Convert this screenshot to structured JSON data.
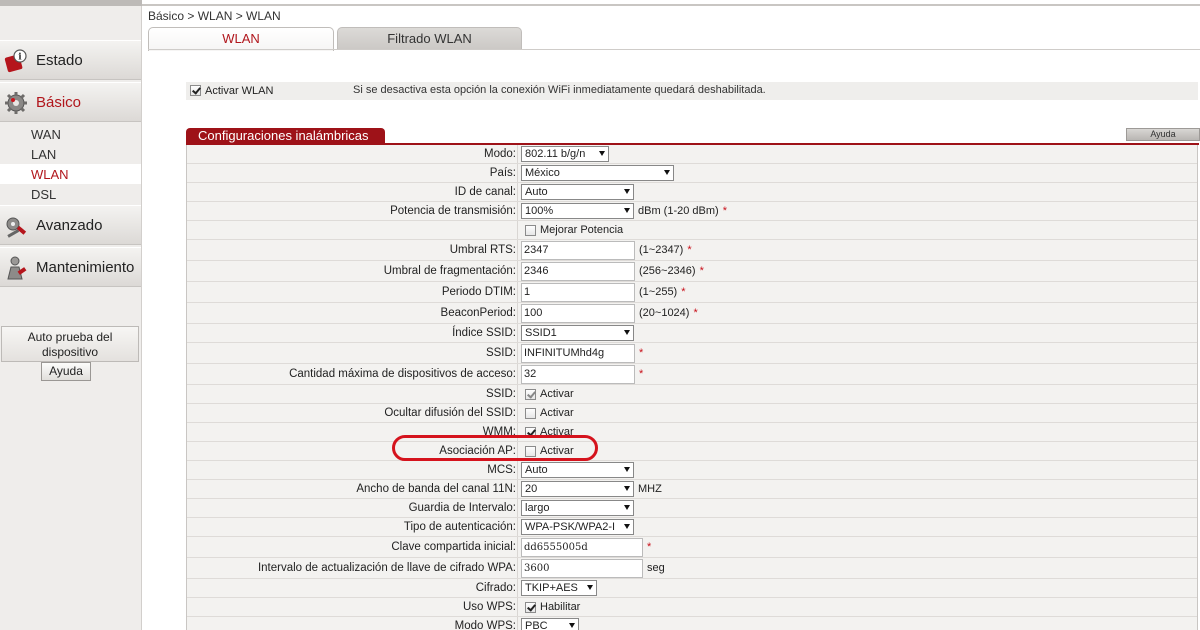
{
  "breadcrumb": "Básico > WLAN > WLAN",
  "tabs": [
    {
      "label": "WLAN",
      "active": true
    },
    {
      "label": "Filtrado WLAN",
      "active": false
    }
  ],
  "sidebar": {
    "menus": [
      {
        "label": "Estado",
        "icon": "info-icon"
      },
      {
        "label": "Básico",
        "icon": "gear-icon",
        "active": true
      },
      {
        "label": "Avanzado",
        "icon": "tools-icon"
      },
      {
        "label": "Mantenimiento",
        "icon": "maintenance-icon"
      }
    ],
    "submenu": [
      "WAN",
      "LAN",
      "WLAN",
      "DSL"
    ],
    "active_submenu": "WLAN",
    "autotest_label": "Auto prueba del dispositivo",
    "help_label": "Ayuda"
  },
  "activate_wlan": {
    "label": "Activar WLAN",
    "checked": true,
    "note": "Si se desactiva esta opción la conexión WiFi inmediatamente quedará deshabilitada."
  },
  "section": {
    "title": "Configuraciones inalámbricas",
    "help_label": "Ayuda"
  },
  "fields": {
    "modo": {
      "label": "Modo:",
      "value": "802.11 b/g/n"
    },
    "pais": {
      "label": "País:",
      "value": "México"
    },
    "canal": {
      "label": "ID de canal:",
      "value": "Auto"
    },
    "potencia": {
      "label": "Potencia de transmisión:",
      "value": "100%",
      "unit": "dBm (1-20 dBm)"
    },
    "mejorar": {
      "label": "Mejorar Potencia",
      "checked": false
    },
    "rts": {
      "label": "Umbral RTS:",
      "value": "2347",
      "range": "(1~2347)"
    },
    "frag": {
      "label": "Umbral de fragmentación:",
      "value": "2346",
      "range": "(256~2346)"
    },
    "dtim": {
      "label": "Periodo DTIM:",
      "value": "1",
      "range": "(1~255)"
    },
    "beacon": {
      "label": "BeaconPeriod:",
      "value": "100",
      "range": "(20~1024)"
    },
    "indice": {
      "label": "Índice SSID:",
      "value": "SSID1"
    },
    "ssid": {
      "label": "SSID:",
      "value": "INFINITUMhd4g"
    },
    "max": {
      "label": "Cantidad máxima de dispositivos de acceso:",
      "value": "32"
    },
    "ssid_en": {
      "label": "SSID:",
      "cb_label": "Activar",
      "checked": true
    },
    "ocultar": {
      "label": "Ocultar difusión del SSID:",
      "cb_label": "Activar",
      "checked": false
    },
    "wmm": {
      "label": "WMM:",
      "cb_label": "Activar",
      "checked": true
    },
    "apiso": {
      "label": "Asociación AP:",
      "cb_label": "Activar",
      "checked": false
    },
    "mcs": {
      "label": "MCS:",
      "value": "Auto"
    },
    "ancho": {
      "label": "Ancho de banda del canal 11N:",
      "value": "20",
      "unit": "MHZ"
    },
    "guardia": {
      "label": "Guardia de Intervalo:",
      "value": "largo"
    },
    "auth": {
      "label": "Tipo de autenticación:",
      "value": "WPA-PSK/WPA2-I"
    },
    "clave": {
      "label": "Clave compartida inicial:",
      "value": "dd6555005d"
    },
    "intervalo": {
      "label": "Intervalo de actualización de llave de cifrado WPA:",
      "value": "3600",
      "unit": "seg"
    },
    "cifrado": {
      "label": "Cifrado:",
      "value": "TKIP+AES"
    },
    "wps": {
      "label": "Uso WPS:",
      "cb_label": "Habilitar",
      "checked": true
    },
    "modo_wps": {
      "label": "Modo WPS:",
      "value": "PBC"
    }
  },
  "required_mark": "*",
  "colors": {
    "brand": "#9e1218",
    "highlight": "#d5131d"
  }
}
